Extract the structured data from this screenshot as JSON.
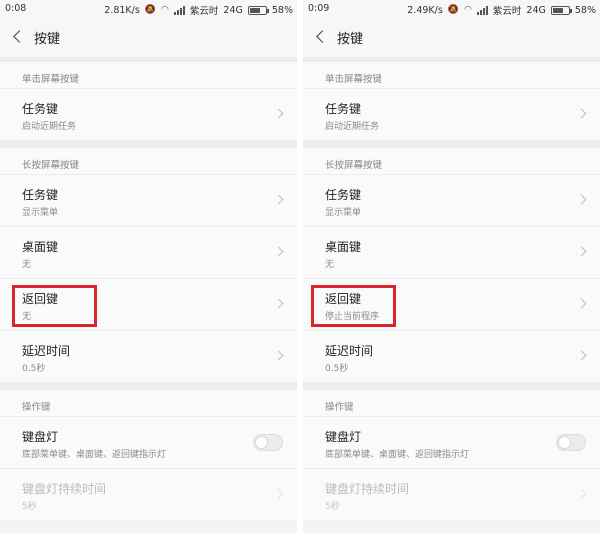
{
  "panels": [
    {
      "status": {
        "time": "0:08",
        "speed": "2.81K/s",
        "carrier": "紫云时",
        "network": "24G",
        "battery": "58%"
      },
      "header": {
        "title": "按键"
      },
      "sections": [
        {
          "label": "单击屏幕按键",
          "items": [
            {
              "title": "任务键",
              "subtitle": "启动近期任务"
            }
          ]
        },
        {
          "label": "长按屏幕按键",
          "items": [
            {
              "title": "任务键",
              "subtitle": "显示菜单"
            },
            {
              "title": "桌面键",
              "subtitle": "无"
            },
            {
              "title": "返回键",
              "subtitle": "无"
            },
            {
              "title": "延迟时间",
              "subtitle": "0.5秒"
            }
          ]
        },
        {
          "label": "操作键",
          "items": [
            {
              "title": "键盘灯",
              "subtitle": "底部菜单键、桌面键、返回键指示灯"
            },
            {
              "title": "键盘灯持续时间",
              "subtitle": "5秒"
            }
          ]
        }
      ]
    },
    {
      "status": {
        "time": "0:09",
        "speed": "2.49K/s",
        "carrier": "紫云时",
        "network": "24G",
        "battery": "58%"
      },
      "header": {
        "title": "按键"
      },
      "sections": [
        {
          "label": "单击屏幕按键",
          "items": [
            {
              "title": "任务键",
              "subtitle": "启动近期任务"
            }
          ]
        },
        {
          "label": "长按屏幕按键",
          "items": [
            {
              "title": "任务键",
              "subtitle": "显示菜单"
            },
            {
              "title": "桌面键",
              "subtitle": "无"
            },
            {
              "title": "返回键",
              "subtitle": "停止当前程序"
            },
            {
              "title": "延迟时间",
              "subtitle": "0.5秒"
            }
          ]
        },
        {
          "label": "操作键",
          "items": [
            {
              "title": "键盘灯",
              "subtitle": "底部菜单键、桌面键、返回键指示灯"
            },
            {
              "title": "键盘灯持续时间",
              "subtitle": "5秒"
            }
          ]
        }
      ]
    }
  ],
  "battery_level": 0.58,
  "colors": {
    "highlight": "#d8262e",
    "background": "#f4f4f4",
    "item_background": "#fafafa"
  },
  "icons": [
    "back-icon",
    "mute-icon",
    "wifi-icon",
    "signal-icon",
    "battery-icon",
    "chevron-right-icon",
    "toggle-switch"
  ]
}
